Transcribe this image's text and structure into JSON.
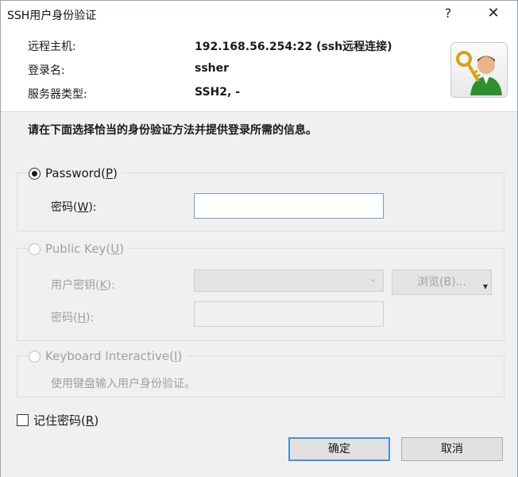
{
  "window": {
    "title": "SSH用户身份验证",
    "help_glyph": "?",
    "close_glyph": "✕"
  },
  "info": {
    "rows": [
      {
        "label": "远程主机:",
        "value": "192.168.56.254:22 (ssh远程连接)"
      },
      {
        "label": "登录名:",
        "value": "ssher"
      },
      {
        "label": "服务器类型:",
        "value": "SSH2, -"
      }
    ],
    "icon": "key-user-icon"
  },
  "instruction": "请在下面选择恰当的身份验证方法并提供登录所需的信息。",
  "password_group": {
    "radio_label": "Password",
    "radio_accel": "P",
    "checked": true,
    "field_label": "密码",
    "field_accel": "W",
    "field_value": ""
  },
  "publickey_group": {
    "radio_label": "Public Key",
    "radio_accel": "U",
    "checked": false,
    "user_key_label": "用户密钥",
    "user_key_accel": "K",
    "user_key_value": "",
    "browse_label": "浏览(B)...",
    "passphrase_label": "密码",
    "passphrase_accel": "H",
    "passphrase_value": ""
  },
  "keyboard_group": {
    "radio_label": "Keyboard Interactive",
    "radio_accel": "I",
    "checked": false,
    "description": "使用键盘输入用户身份验证。"
  },
  "remember": {
    "label": "记住密码",
    "accel": "R",
    "checked": false
  },
  "buttons": {
    "ok": "确定",
    "cancel": "取消"
  },
  "colors": {
    "default_button_border": "#4a90d9",
    "dialog_bg": "#f0f0f0"
  }
}
